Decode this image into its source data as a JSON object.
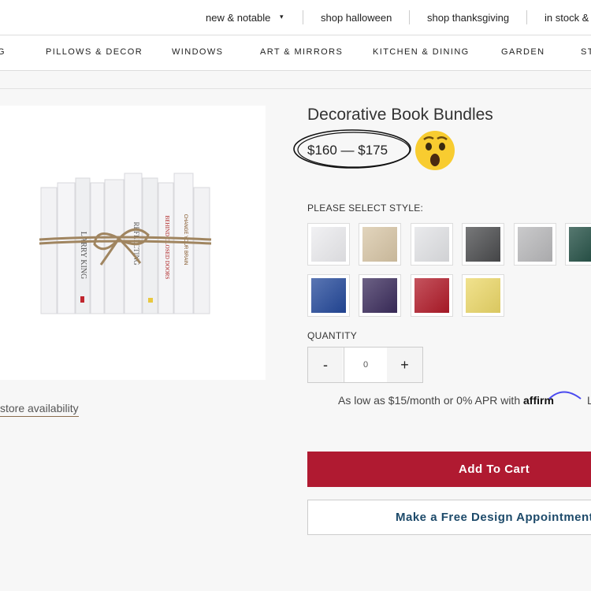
{
  "top_nav": {
    "links": [
      {
        "label": "new & notable"
      },
      {
        "label": "shop halloween"
      },
      {
        "label": "shop thanksgiving"
      },
      {
        "label": "in stock &"
      }
    ],
    "dropdown_glyph": "▾"
  },
  "categories": [
    "G",
    "PILLOWS & DECOR",
    "WINDOWS",
    "ART & MIRRORS",
    "KITCHEN & DINING",
    "GARDEN",
    "ST"
  ],
  "product": {
    "title": "Decorative Book Bundles",
    "price_range": "$160 — $175",
    "emoji": "surprised-face-emoji",
    "store_availability_link": "store availability",
    "book_spines": [
      "LARRY KING",
      "REFLECTING",
      "BEHIND CLOSED DOORS",
      "CHANGE YOUR BRAIN"
    ]
  },
  "style_selector": {
    "label": "PLEASE SELECT STYLE:",
    "swatches": [
      {
        "name": "white",
        "color": "#ececef"
      },
      {
        "name": "tan",
        "color": "#d8c6a6"
      },
      {
        "name": "light-gray",
        "color": "#e2e3e6"
      },
      {
        "name": "charcoal",
        "color": "#4a4b4d"
      },
      {
        "name": "silver",
        "color": "#b8b8ba"
      },
      {
        "name": "green",
        "color": "#1e4b40"
      },
      {
        "name": "blue",
        "color": "#23489a"
      },
      {
        "name": "purple",
        "color": "#3b2c5c"
      },
      {
        "name": "red",
        "color": "#b11a28"
      },
      {
        "name": "yellow",
        "color": "#ecd868"
      }
    ]
  },
  "quantity": {
    "label": "QUANTITY",
    "minus": "-",
    "value": "0",
    "plus": "+"
  },
  "financing": {
    "text": "As low as $15/month or 0% APR with",
    "brand": "affirm",
    "trailing": "L"
  },
  "buttons": {
    "add_to_cart": "Add To Cart",
    "design_appointment": "Make a Free Design Appointment"
  },
  "colors": {
    "accent_red": "#b01a31",
    "navy_text": "#1d4a6a"
  }
}
